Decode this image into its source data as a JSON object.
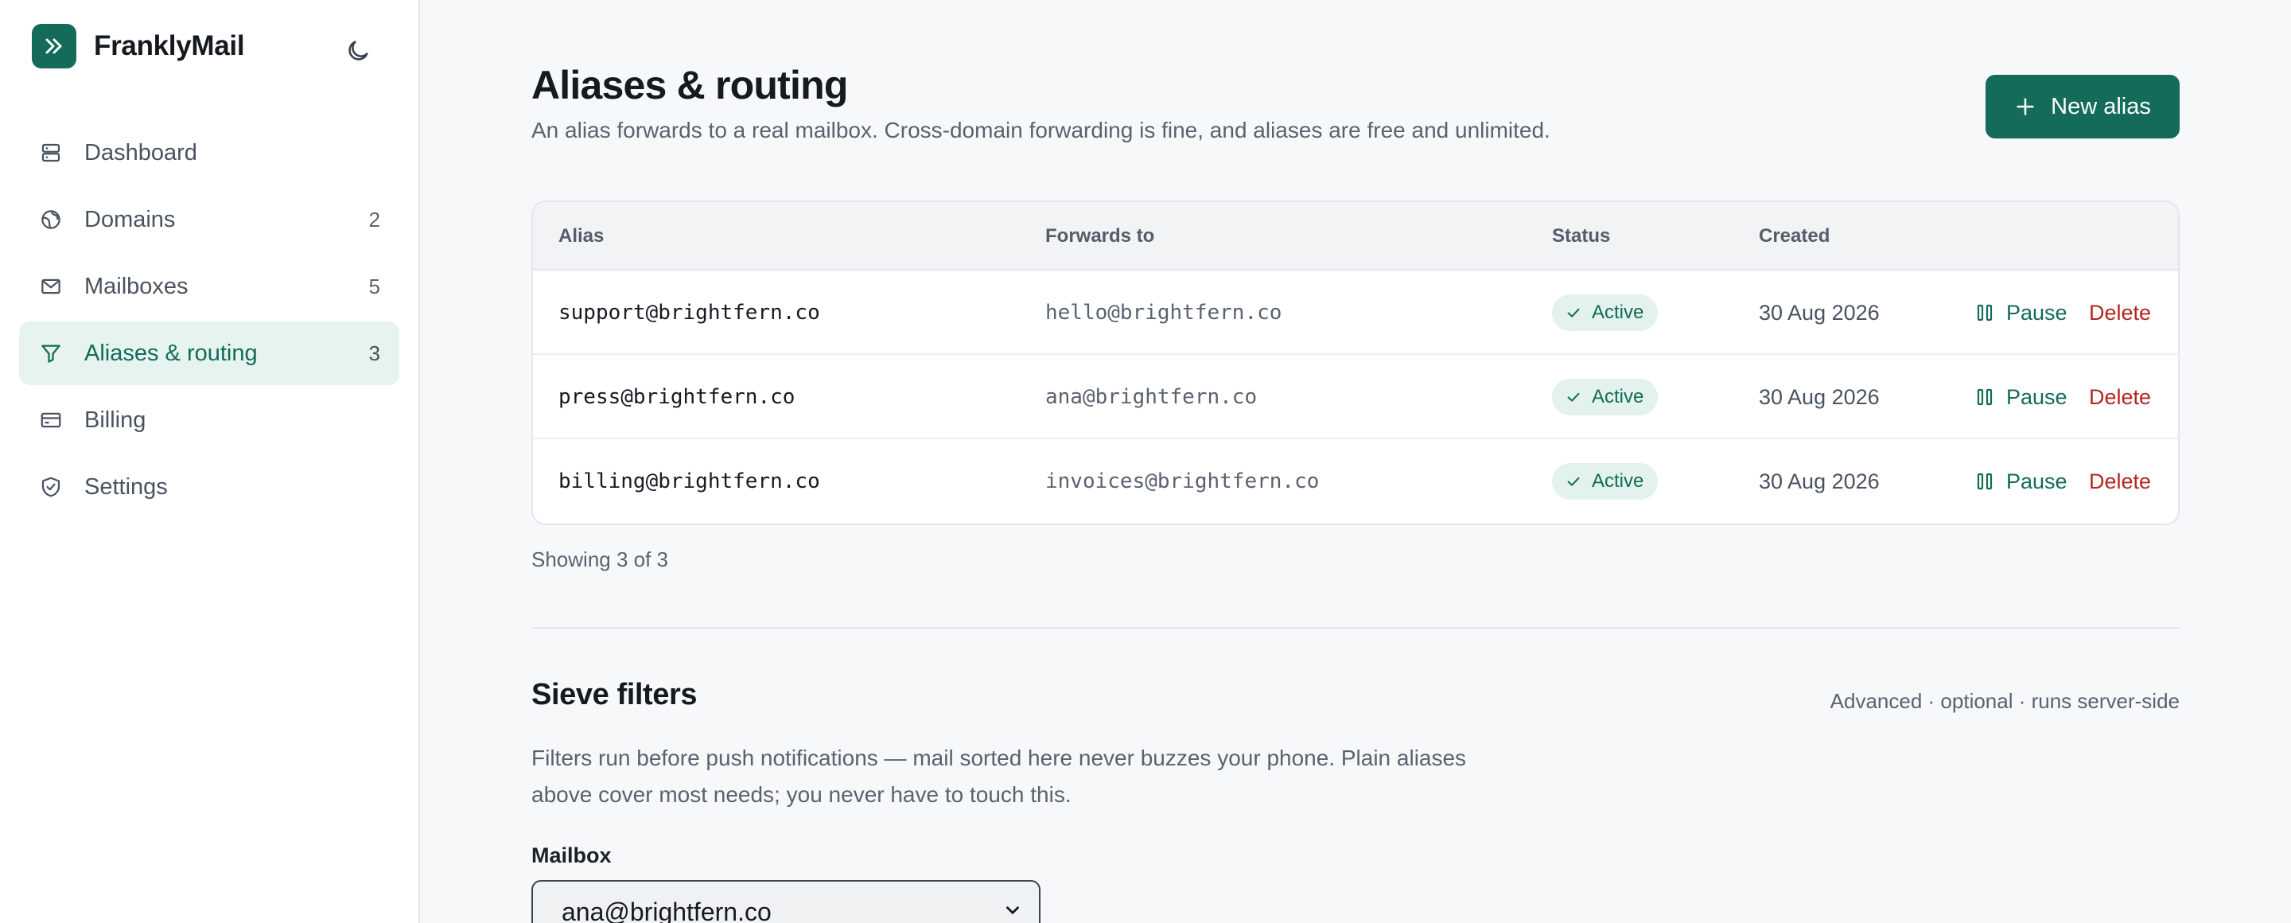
{
  "app": {
    "name": "FranklyMail"
  },
  "sidebar": {
    "items": [
      {
        "label": "Dashboard",
        "count": "",
        "icon": "dashboard-icon"
      },
      {
        "label": "Domains",
        "count": "2",
        "icon": "globe-icon"
      },
      {
        "label": "Mailboxes",
        "count": "5",
        "icon": "mail-icon"
      },
      {
        "label": "Aliases & routing",
        "count": "3",
        "icon": "filter-icon",
        "active": true
      },
      {
        "label": "Billing",
        "count": "",
        "icon": "credit-card-icon"
      },
      {
        "label": "Settings",
        "count": "",
        "icon": "shield-check-icon"
      }
    ]
  },
  "page": {
    "title": "Aliases & routing",
    "subtitle": "An alias forwards to a real mailbox. Cross-domain forwarding is fine, and aliases are free and unlimited.",
    "new_alias_label": "New alias"
  },
  "table": {
    "headers": {
      "alias": "Alias",
      "forwards": "Forwards to",
      "status": "Status",
      "created": "Created"
    },
    "rows": [
      {
        "alias": "support@brightfern.co",
        "forwards": "hello@brightfern.co",
        "status": "Active",
        "created": "30 Aug 2026",
        "pause": "Pause",
        "delete": "Delete"
      },
      {
        "alias": "press@brightfern.co",
        "forwards": "ana@brightfern.co",
        "status": "Active",
        "created": "30 Aug 2026",
        "pause": "Pause",
        "delete": "Delete"
      },
      {
        "alias": "billing@brightfern.co",
        "forwards": "invoices@brightfern.co",
        "status": "Active",
        "created": "30 Aug 2026",
        "pause": "Pause",
        "delete": "Delete"
      }
    ],
    "showing": "Showing 3 of 3"
  },
  "sieve": {
    "title": "Sieve filters",
    "meta": "Advanced · optional · runs server-side",
    "description": "Filters run before push notifications — mail sorted here never buzzes your phone. Plain aliases above cover most needs; you never have to touch this.",
    "mailbox_label": "Mailbox",
    "mailbox_value": "ana@brightfern.co"
  },
  "colors": {
    "accent": "#146b5a",
    "danger": "#b3261e",
    "active_bg": "#e6f3ef"
  }
}
